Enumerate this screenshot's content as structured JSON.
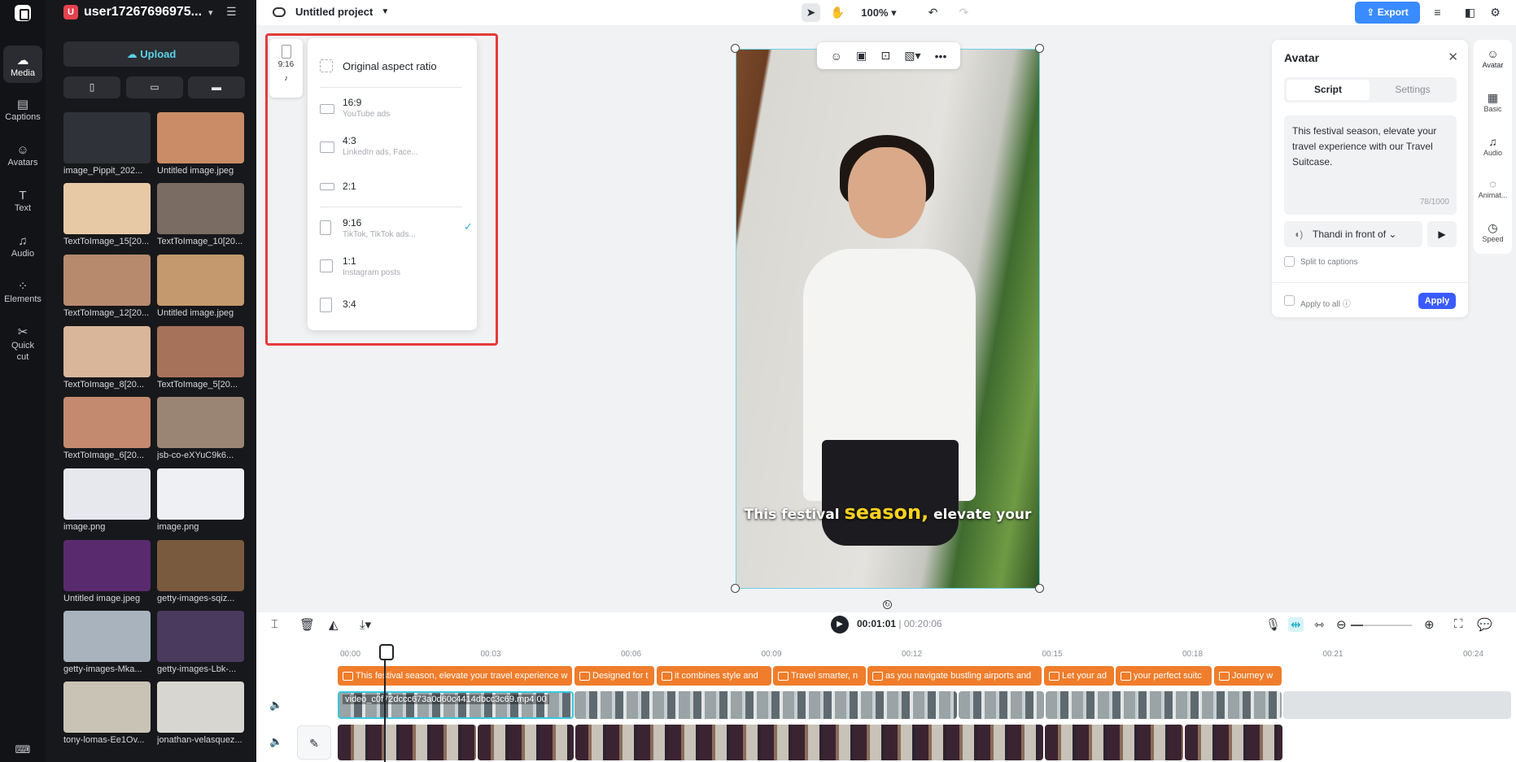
{
  "rail": {
    "items": [
      {
        "label": "Media",
        "icon": "media-icon",
        "glyph": "☁"
      },
      {
        "label": "Captions",
        "icon": "captions-icon",
        "glyph": "▤"
      },
      {
        "label": "Avatars",
        "icon": "avatars-icon",
        "glyph": "☺"
      },
      {
        "label": "Text",
        "icon": "text-icon",
        "glyph": "T"
      },
      {
        "label": "Audio",
        "icon": "audio-icon",
        "glyph": "♫"
      },
      {
        "label": "Elements",
        "icon": "elements-icon",
        "glyph": "⁘"
      },
      {
        "label": "Quick cut",
        "icon": "quick-cut-icon",
        "glyph": "✂"
      }
    ]
  },
  "media": {
    "user_initial": "U",
    "username": "user17267696975...",
    "upload_label": "Upload",
    "format_icons": [
      "▯",
      "▭",
      "▬"
    ],
    "assets": [
      {
        "label": "image_Pippit_202...",
        "color": "#2f3238"
      },
      {
        "label": "Untitled image.jpeg",
        "color": "#c98c66"
      },
      {
        "label": "TextToImage_15[20...",
        "color": "#e8c9a6"
      },
      {
        "label": "TextToImage_10[20...",
        "color": "#7a6c62"
      },
      {
        "label": "TextToImage_12[20...",
        "color": "#b78a6e"
      },
      {
        "label": "Untitled image.jpeg",
        "color": "#c4996e"
      },
      {
        "label": "TextToImage_8[20...",
        "color": "#d9b59a"
      },
      {
        "label": "TextToImage_5[20...",
        "color": "#a6735a"
      },
      {
        "label": "TextToImage_6[20...",
        "color": "#c48a70"
      },
      {
        "label": "jsb-co-eXYuC9k6...",
        "color": "#9a8574"
      },
      {
        "label": "image.png",
        "color": "#e6e8ee"
      },
      {
        "label": "image.png",
        "color": "#eef0f4"
      },
      {
        "label": "Untitled image.jpeg",
        "color": "#5a2a6e"
      },
      {
        "label": "getty-images-sqiz...",
        "color": "#7a5a3e"
      },
      {
        "label": "getty-images-Mka...",
        "color": "#a9b3be"
      },
      {
        "label": "getty-images-Lbk-...",
        "color": "#4a3a5e"
      },
      {
        "label": "tony-lomas-Ee1Ov...",
        "color": "#c9c3b6"
      },
      {
        "label": "jonathan-velasquez...",
        "color": "#d8d6d0"
      }
    ]
  },
  "topbar": {
    "project_title": "Untitled project",
    "zoom": "100%",
    "export_label": "Export"
  },
  "aspect_ratio": {
    "current": "9:16",
    "original_label": "Original aspect ratio",
    "options": [
      {
        "title": "16:9",
        "subtitle": "YouTube ads"
      },
      {
        "title": "4:3",
        "subtitle": "LinkedIn ads, Face..."
      },
      {
        "title": "2:1",
        "subtitle": ""
      },
      {
        "title": "9:16",
        "subtitle": "TikTok, TikTok ads...",
        "selected": true
      },
      {
        "title": "1:1",
        "subtitle": "Instagram posts"
      },
      {
        "title": "3:4",
        "subtitle": ""
      }
    ]
  },
  "canvas": {
    "caption_before": "This festival ",
    "caption_highlight": "season,",
    "caption_after": " elevate your"
  },
  "avatar_panel": {
    "title": "Avatar",
    "tab_script": "Script",
    "tab_settings": "Settings",
    "script_text": "This festival season, elevate your travel experience with our Travel Suitcase.",
    "char_count": "78/1000",
    "voice": "Thandi in front of",
    "split_captions": "Split to captions",
    "apply_to_all": "Apply to all",
    "apply_label": "Apply"
  },
  "right_tools": [
    {
      "label": "Avatar",
      "icon": "avatar-tool-icon",
      "glyph": "☺"
    },
    {
      "label": "Basic",
      "icon": "basic-tool-icon",
      "glyph": "▦"
    },
    {
      "label": "Audio",
      "icon": "audio-tool-icon",
      "glyph": "♫"
    },
    {
      "label": "Animat...",
      "icon": "animation-tool-icon",
      "glyph": "◌"
    },
    {
      "label": "Speed",
      "icon": "speed-tool-icon",
      "glyph": "◷"
    }
  ],
  "timeline": {
    "current_time": "00:01:01",
    "separator": "|",
    "total_time": "00:20:06",
    "ruler": [
      "00:00",
      "00:03",
      "00:06",
      "00:09",
      "00:12",
      "00:15",
      "00:18",
      "00:21",
      "00:24"
    ],
    "caption_clips": [
      "This festival season, elevate your travel experience w",
      "Designed for t",
      "it combines style and",
      "Travel smarter, n",
      "as you navigate bustling airports and",
      "Let your ad",
      "your perfect suitc",
      "Journey w"
    ],
    "video_clip_name": "video_c0f72dccc673a0d60c4414dbcc3c69.mp4",
    "video_clip_suffix": "00"
  }
}
